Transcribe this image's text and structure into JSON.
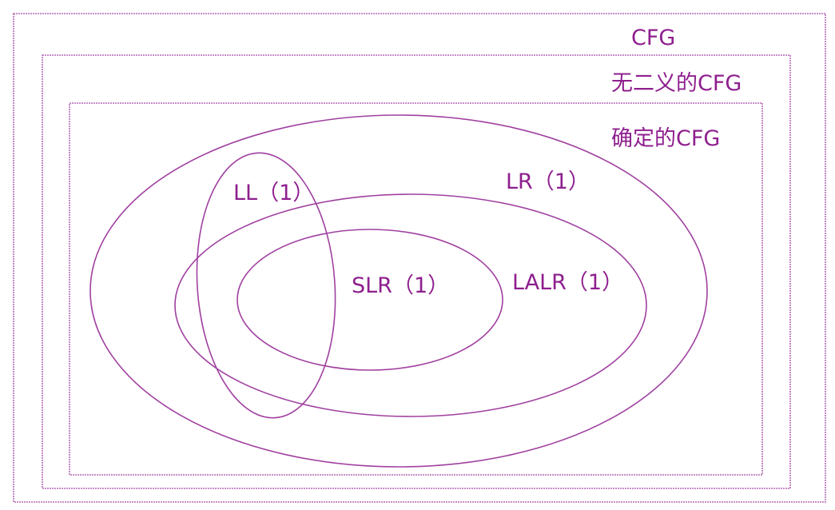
{
  "colors": {
    "stroke": "#a040a0",
    "text": "#8e1f8e",
    "background": "#ffffff"
  },
  "labels": {
    "cfg": "CFG",
    "unambiguous_cfg": "无二义的CFG",
    "deterministic_cfg": "确定的CFG",
    "ll1": "LL（1）",
    "lr1": "LR（1）",
    "slr1": "SLR（1）",
    "lalr1": "LALR（1）"
  }
}
